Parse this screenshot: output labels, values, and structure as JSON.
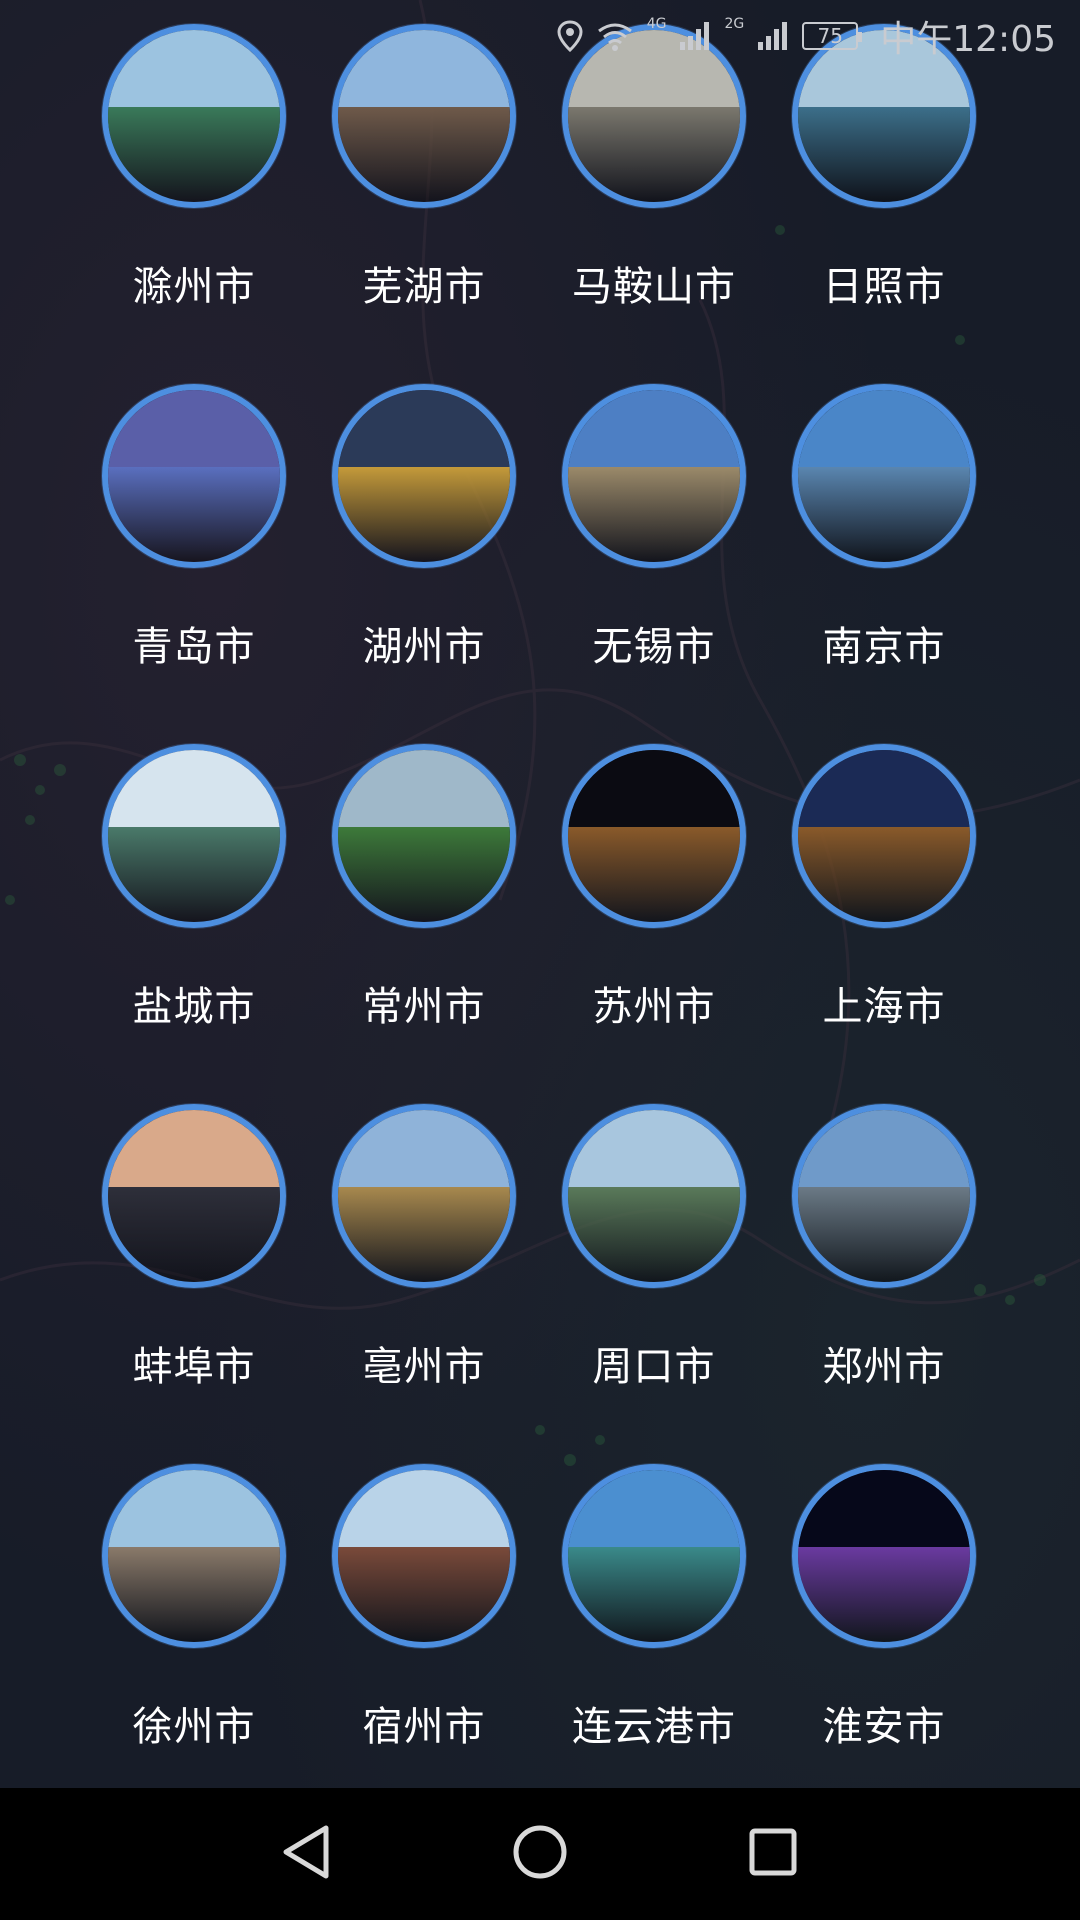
{
  "status_bar": {
    "time": "中午12:05",
    "battery": "75",
    "network_1": "4G",
    "network_2": "2G",
    "icons": [
      "location-icon",
      "wifi-icon",
      "signal-icon",
      "signal-icon",
      "battery-icon"
    ]
  },
  "cities": [
    {
      "name": "滁州市",
      "sky": "#9cc3e0",
      "ground": "#3a7a5a"
    },
    {
      "name": "芜湖市",
      "sky": "#8fb6dd",
      "ground": "#6f5a4a"
    },
    {
      "name": "马鞍山市",
      "sky": "#b7b7b0",
      "ground": "#7b786e"
    },
    {
      "name": "日照市",
      "sky": "#a9c7db",
      "ground": "#3c6f8a"
    },
    {
      "name": "青岛市",
      "sky": "#5a5fa8",
      "ground": "#5a6fbf"
    },
    {
      "name": "湖州市",
      "sky": "#2b3a58",
      "ground": "#c49a3a"
    },
    {
      "name": "无锡市",
      "sky": "#4d7fc4",
      "ground": "#9b8a6a"
    },
    {
      "name": "南京市",
      "sky": "#4a86c8",
      "ground": "#5a86b0"
    },
    {
      "name": "盐城市",
      "sky": "#d6e4ee",
      "ground": "#4a7a6a"
    },
    {
      "name": "常州市",
      "sky": "#9fb8c9",
      "ground": "#3d7a3a"
    },
    {
      "name": "苏州市",
      "sky": "#0b0b12",
      "ground": "#8a5a2a"
    },
    {
      "name": "上海市",
      "sky": "#1b2a55",
      "ground": "#8a5a2a"
    },
    {
      "name": "蚌埠市",
      "sky": "#d9a98a",
      "ground": "#2e2f3a"
    },
    {
      "name": "亳州市",
      "sky": "#8fb3d9",
      "ground": "#a8894e"
    },
    {
      "name": "周口市",
      "sky": "#a8c6de",
      "ground": "#5a7a5a"
    },
    {
      "name": "郑州市",
      "sky": "#6f9ac9",
      "ground": "#6b7a86"
    },
    {
      "name": "徐州市",
      "sky": "#9cc3e0",
      "ground": "#8a7a6a"
    },
    {
      "name": "宿州市",
      "sky": "#b9d3e8",
      "ground": "#7a4a3a"
    },
    {
      "name": "连云港市",
      "sky": "#4b8fd0",
      "ground": "#3a8a8a"
    },
    {
      "name": "淮安市",
      "sky": "#06081a",
      "ground": "#6a3aa0"
    }
  ],
  "nav": {
    "back": "back-icon",
    "home": "home-icon",
    "recent": "recent-apps-icon"
  }
}
